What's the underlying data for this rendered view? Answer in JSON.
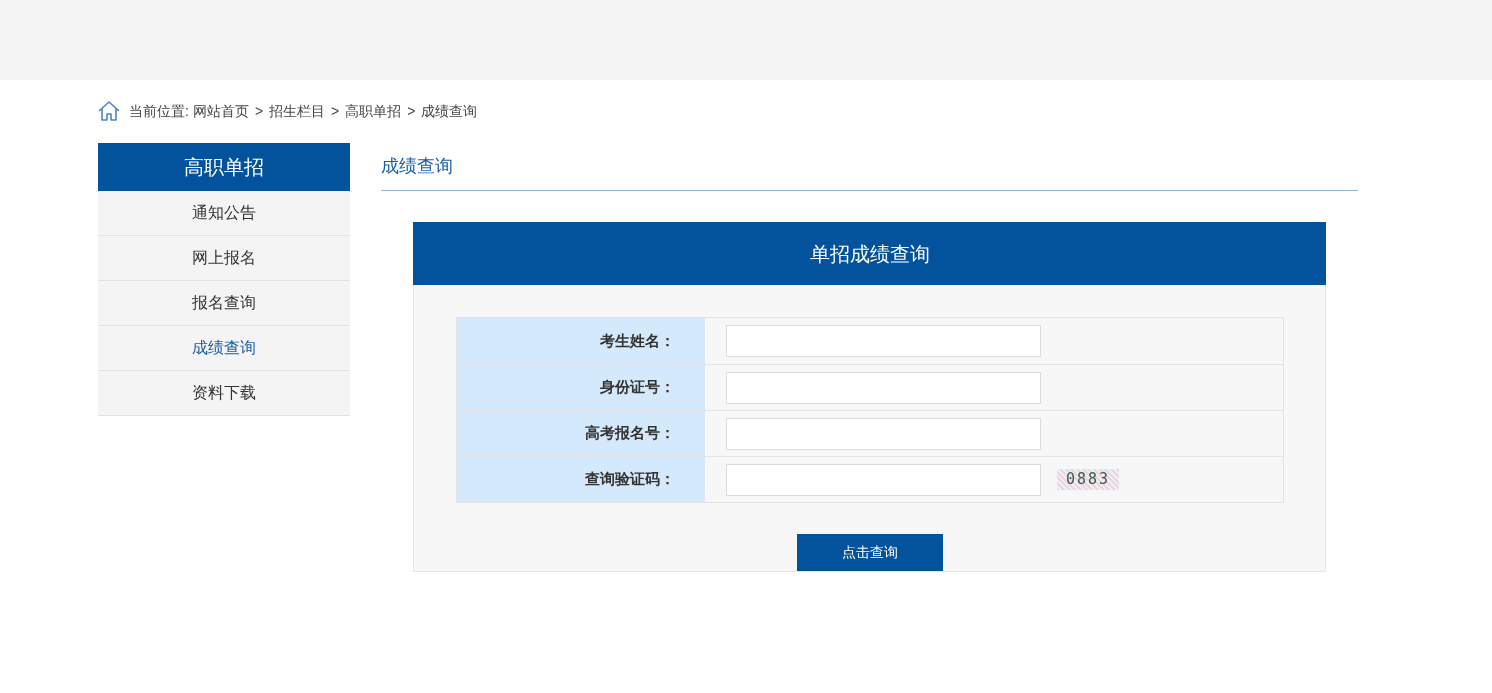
{
  "breadcrumb": {
    "label": "当前位置:",
    "items": [
      {
        "label": "网站首页"
      },
      {
        "separator": ">",
        "label": "招生栏目"
      },
      {
        "separator": ">",
        "label": "高职单招"
      },
      {
        "separator": ">",
        "label": "成绩查询"
      }
    ]
  },
  "sidebar": {
    "title": "高职单招",
    "items": [
      {
        "label": "通知公告",
        "selected": false
      },
      {
        "label": "网上报名",
        "selected": false
      },
      {
        "label": "报名查询",
        "selected": false
      },
      {
        "label": "成绩查询",
        "selected": true
      },
      {
        "label": "资料下载",
        "selected": false
      }
    ]
  },
  "main": {
    "title": "成绩查询",
    "panel": {
      "title": "单招成绩查询",
      "fields": [
        {
          "kind": "text",
          "label": "考生姓名："
        },
        {
          "kind": "text",
          "label": "身份证号："
        },
        {
          "kind": "text",
          "label": "高考报名号："
        },
        {
          "kind": "captcha",
          "label": "查询验证码：",
          "captcha": "0883"
        }
      ],
      "submit_button": "点击查询"
    }
  }
}
